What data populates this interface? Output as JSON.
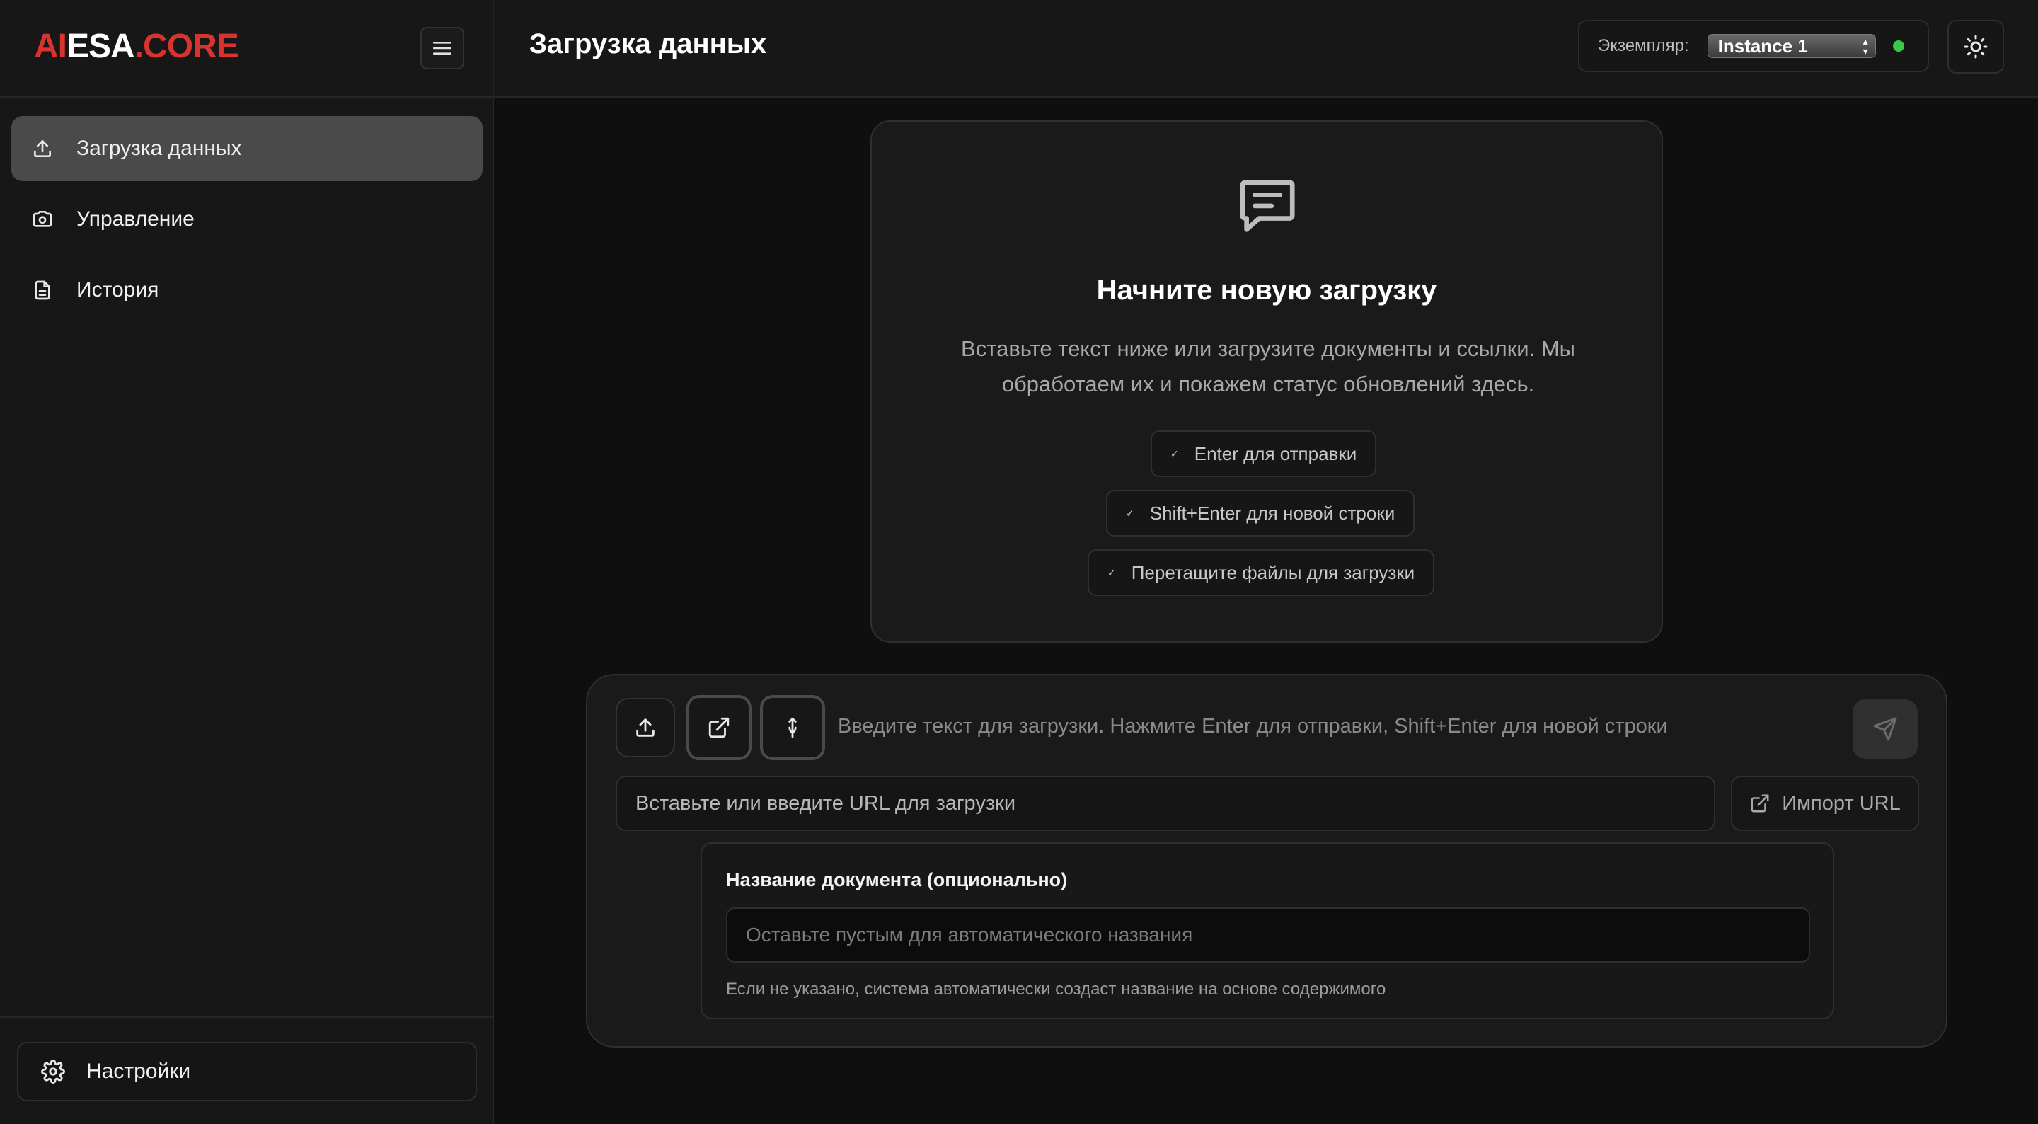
{
  "logo": {
    "part1": "AI",
    "part2": "ESA",
    "part3": ".CORE"
  },
  "sidebar": {
    "items": [
      {
        "label": "Загрузка данных",
        "icon": "upload-icon",
        "active": true
      },
      {
        "label": "Управление",
        "icon": "camera-icon",
        "active": false
      },
      {
        "label": "История",
        "icon": "document-icon",
        "active": false
      }
    ],
    "settings_label": "Настройки"
  },
  "header": {
    "title": "Загрузка данных",
    "instance_label": "Экземпляр:",
    "instance_value": "Instance 1",
    "status_color": "#3cc84b"
  },
  "welcome": {
    "title": "Начните новую загрузку",
    "description": "Вставьте текст ниже или загрузите документы и ссылки. Мы обработаем их и покажем статус обновлений здесь.",
    "hints": [
      "Enter для отправки",
      "Shift+Enter для новой строки",
      "Перетащите файлы для загрузки"
    ]
  },
  "composer": {
    "text_placeholder": "Введите текст для загрузки. Нажмите Enter для отправки, Shift+Enter для новой строки",
    "url_placeholder": "Вставьте или введите URL для загрузки",
    "import_label": "Импорт URL",
    "docname_label": "Название документа (опционально)",
    "docname_placeholder": "Оставьте пустым для автоматического названия",
    "docname_hint": "Если не указано, система автоматически создаст название на основе содержимого"
  },
  "colors": {
    "accent_red": "#d8342f",
    "background": "#0f0f0f",
    "panel": "#171717"
  }
}
